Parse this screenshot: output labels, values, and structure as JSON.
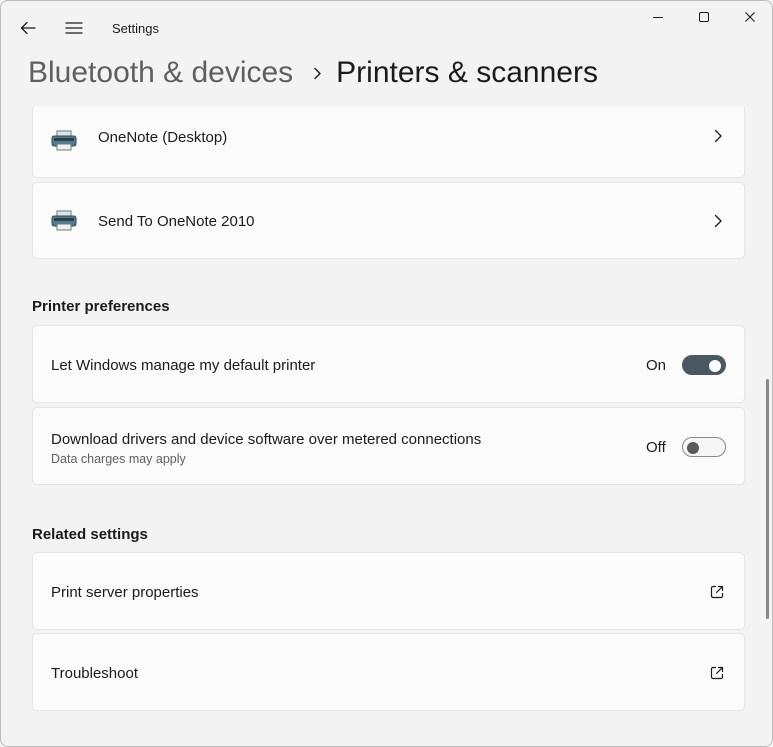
{
  "window": {
    "app_title": "Settings"
  },
  "breadcrumb": {
    "parent": "Bluetooth & devices",
    "current": "Printers & scanners"
  },
  "printers": [
    {
      "name": "OneNote (Desktop)"
    },
    {
      "name": "Send To OneNote 2010"
    }
  ],
  "printer_preferences": {
    "heading": "Printer preferences",
    "default_printer": {
      "label": "Let Windows manage my default printer",
      "state_text": "On",
      "enabled": true
    },
    "metered": {
      "label": "Download drivers and device software over metered connections",
      "sublabel": "Data charges may apply",
      "state_text": "Off",
      "enabled": false
    }
  },
  "related_settings": {
    "heading": "Related settings",
    "items": [
      {
        "label": "Print server properties"
      },
      {
        "label": "Troubleshoot"
      }
    ]
  },
  "colors": {
    "toggle_on": "#4a5862",
    "background": "#f3f3f3",
    "card": "#fbfbfb"
  },
  "icons": {
    "back": "back-arrow-icon",
    "menu": "hamburger-menu-icon",
    "printer": "printer-icon",
    "chevron": "chevron-right-icon",
    "external": "open-external-icon"
  }
}
